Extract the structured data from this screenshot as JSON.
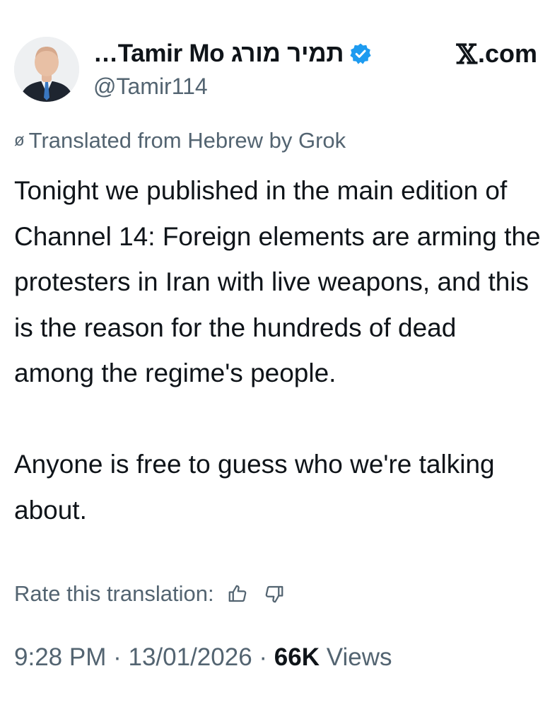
{
  "header": {
    "display_name": "…Tamir Mo תמיר מורג",
    "handle": "@Tamir114",
    "brand_label": ".com",
    "brand_icon": "x-logo-icon",
    "avatar_icon": "profile-photo-avatar",
    "verified_icon": "verified-badge-icon",
    "verified_color": "#1d9bf0"
  },
  "translation": {
    "icon": "globe-slash-icon",
    "label": "Translated from Hebrew by Grok"
  },
  "tweet": {
    "paragraph_1": "Tonight we published in the main edition of Channel 14: Foreign elements are arming the protesters in Iran with live weapons, and this is the reason for the hundreds of dead among the regime's people.",
    "paragraph_2": "Anyone is free to guess who we're talking about."
  },
  "rating": {
    "label": "Rate this translation:",
    "thumbs_up_icon": "thumbs-up-icon",
    "thumbs_down_icon": "thumbs-down-icon"
  },
  "meta": {
    "time": "9:28 PM",
    "separator": "·",
    "date": "13/01/2026",
    "views_count": "66K",
    "views_label": "Views"
  },
  "colors": {
    "text_primary": "#0f1419",
    "text_secondary": "#536471",
    "background": "#ffffff"
  }
}
